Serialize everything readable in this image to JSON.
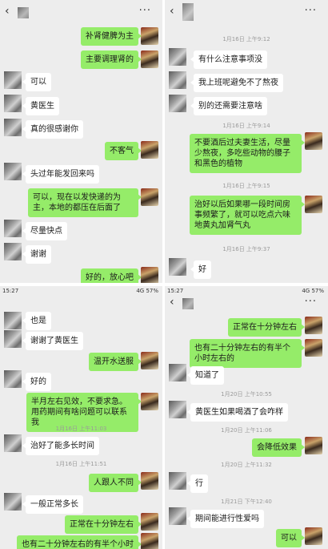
{
  "icons": {
    "back": "‹",
    "more": "···"
  },
  "colors": {
    "sent_bubble": "#95ec69",
    "received_bubble": "#ffffff",
    "background": "#ededed"
  },
  "panel1": {
    "messages": [
      {
        "side": "right",
        "text": "补肾健脾为主"
      },
      {
        "side": "right",
        "text": "主要调理肾的"
      },
      {
        "side": "left",
        "text": "可以"
      },
      {
        "side": "left",
        "text": "黄医生"
      },
      {
        "side": "left",
        "text": "真的很感谢你"
      },
      {
        "side": "right",
        "text": "不客气"
      },
      {
        "side": "left",
        "text": "头过年能发回来吗"
      },
      {
        "side": "right",
        "text": "可以，现在以发快递的为主，本地的都压在后面了"
      },
      {
        "side": "left",
        "text": "尽量快点"
      },
      {
        "side": "left",
        "text": "谢谢"
      },
      {
        "side": "right",
        "text": "好的，放心吧"
      }
    ]
  },
  "panel2": {
    "timestamps": [
      "1月16日 上午9:12",
      "1月16日 上午9:14",
      "1月16日 上午9:15",
      "1月16日 上午9:37"
    ],
    "messages": [
      {
        "side": "left",
        "text": "有什么注意事项没"
      },
      {
        "side": "left",
        "text": "我上班呢避免不了熬夜"
      },
      {
        "side": "left",
        "text": "别的还需要注意啥"
      },
      {
        "side": "right",
        "text": "不要酒后过夫妻生活，尽量少熬夜，多吃些动物的腰子和黑色的植物"
      },
      {
        "side": "right",
        "text": "治好以后如果哪一段时间房事频繁了，就可以吃点六味地黄丸加肾气丸"
      },
      {
        "side": "left",
        "text": "好"
      }
    ]
  },
  "panel3": {
    "status": {
      "time": "15:27",
      "signal": "4G",
      "battery": "57%"
    },
    "timestamps": [
      "1月16日 上午11:03",
      "1月16日 上午11:51"
    ],
    "messages": [
      {
        "side": "left",
        "text": "也是"
      },
      {
        "side": "left",
        "text": "谢谢了黄医生"
      },
      {
        "side": "right",
        "text": "温开水送服"
      },
      {
        "side": "left",
        "text": "好的"
      },
      {
        "side": "right",
        "text": "半月左右见效，不要求急。用药期间有啥问题可以联系我"
      },
      {
        "side": "left",
        "text": "治好了能多长时间"
      },
      {
        "side": "right",
        "text": "人跟人不同"
      },
      {
        "side": "left",
        "text": "一般正常多长"
      },
      {
        "side": "right",
        "text": "正常在十分钟左右"
      },
      {
        "side": "right",
        "text": "也有二十分钟左右的有半个小时"
      }
    ]
  },
  "panel4": {
    "status": {
      "time": "15:27",
      "signal": "4G",
      "battery": "57%"
    },
    "timestamps": [
      "1月20日 上午10:55",
      "1月20日 上午11:06",
      "1月20日 上午11:32",
      "1月21日 下午12:40"
    ],
    "messages": [
      {
        "side": "right",
        "text": "正常在十分钟左右"
      },
      {
        "side": "right",
        "text": "也有二十分钟左右的有半个小时左右的"
      },
      {
        "side": "left",
        "text": "知道了"
      },
      {
        "side": "left",
        "text": "黄医生如果喝酒了会咋样"
      },
      {
        "side": "right",
        "text": "会降低效果"
      },
      {
        "side": "left",
        "text": "行"
      },
      {
        "side": "left",
        "text": "期间能进行性爱吗"
      },
      {
        "side": "right",
        "text": "可以"
      }
    ]
  }
}
